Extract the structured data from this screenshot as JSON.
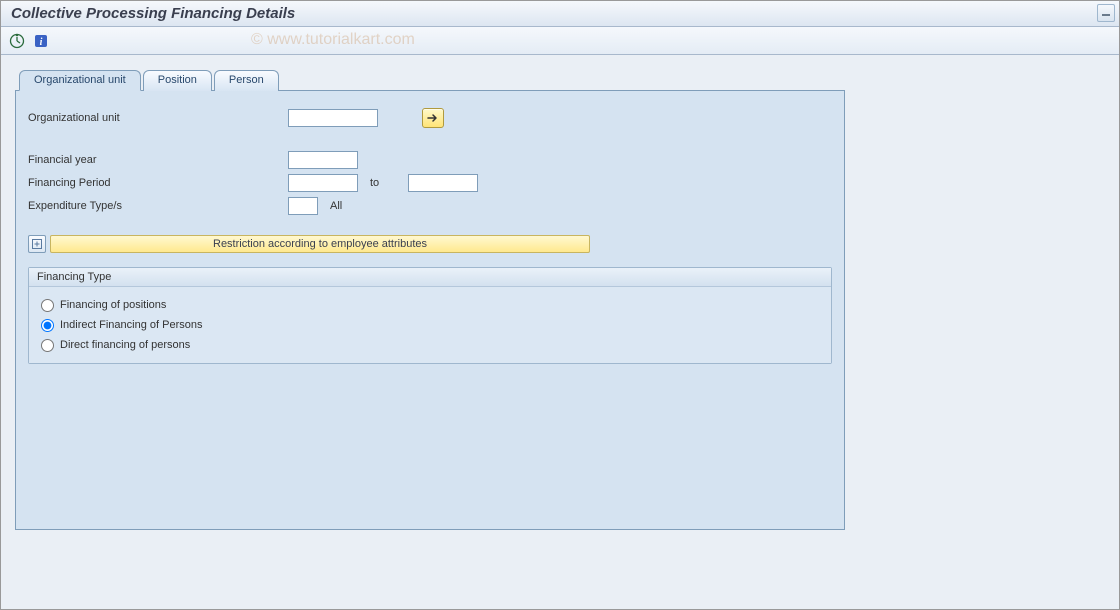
{
  "title": "Collective Processing Financing Details",
  "watermark": "© www.tutorialkart.com",
  "toolbar": {
    "execute_icon": "execute-icon",
    "info_icon": "info-icon"
  },
  "tabs": [
    {
      "label": "Organizational unit",
      "active": true
    },
    {
      "label": "Position",
      "active": false
    },
    {
      "label": "Person",
      "active": false
    }
  ],
  "form": {
    "org_unit_label": "Organizational unit",
    "org_unit_value": "",
    "fin_year_label": "Financial year",
    "fin_year_value": "",
    "fin_period_label": "Financing Period",
    "fin_period_from": "",
    "to_label": "to",
    "fin_period_to": "",
    "exp_type_label": "Expenditure Type/s",
    "exp_type_value": "",
    "exp_type_text": "All"
  },
  "expand": {
    "label": "Restriction according to employee attributes"
  },
  "group": {
    "title": "Financing Type",
    "options": [
      {
        "label": "Financing of positions",
        "selected": false
      },
      {
        "label": "Indirect Financing of Persons",
        "selected": true
      },
      {
        "label": "Direct financing of persons",
        "selected": false
      }
    ]
  }
}
